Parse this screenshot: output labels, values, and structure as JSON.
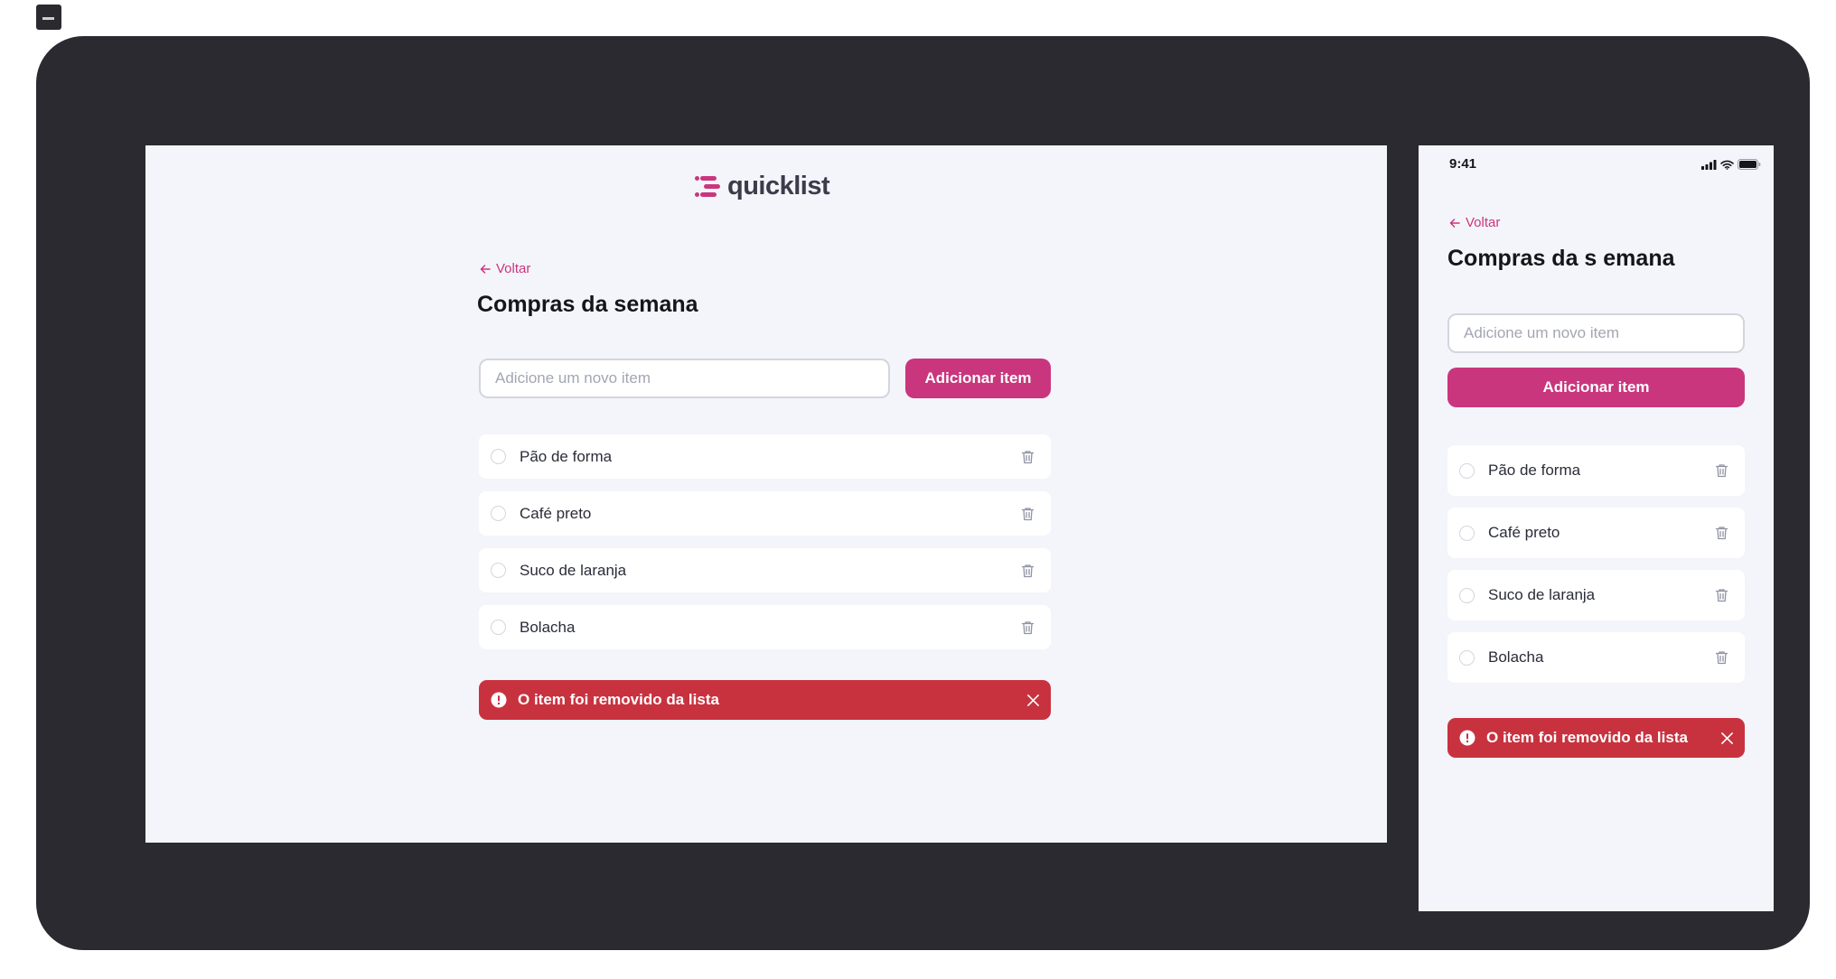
{
  "brand": {
    "name": "quicklist",
    "accent_color": "#c9367e",
    "toast_color": "#c8323f",
    "background_color": "#f4f5fa"
  },
  "desktop": {
    "back_label": "Voltar",
    "title": "Compras da semana",
    "input_placeholder": "Adicione um novo item",
    "add_button": "Adicionar item",
    "items": [
      {
        "label": "Pão de forma"
      },
      {
        "label": "Café preto"
      },
      {
        "label": "Suco de laranja"
      },
      {
        "label": "Bolacha"
      }
    ],
    "toast": {
      "message": "O item foi removido da lista",
      "icon": "alert-circle-icon"
    }
  },
  "mobile": {
    "status_time": "9:41",
    "back_label": "Voltar",
    "title": "Compras da s emana",
    "input_placeholder": "Adicione um novo item",
    "add_button": "Adicionar item",
    "items": [
      {
        "label": "Pão de forma"
      },
      {
        "label": "Café preto"
      },
      {
        "label": "Suco de laranja"
      },
      {
        "label": "Bolacha"
      }
    ],
    "toast": {
      "message": "O item foi removido da lista",
      "icon": "alert-circle-icon"
    }
  }
}
